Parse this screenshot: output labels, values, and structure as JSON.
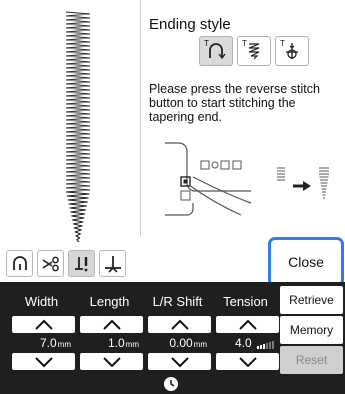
{
  "ending_style": {
    "title": "Ending style",
    "buttons": [
      {
        "prefix": "T",
        "icon": "reverse-tack-icon",
        "selected": true
      },
      {
        "prefix": "T",
        "icon": "zigzag-taper-icon",
        "selected": false
      },
      {
        "prefix": "T",
        "icon": "tie-off-icon",
        "selected": false
      }
    ],
    "instruction": "Please press the reverse stitch button to start stitching the tapering end."
  },
  "side_toolbar": {
    "buttons": [
      {
        "icon": "presser-foot-icon",
        "active": false
      },
      {
        "icon": "scissors-icon",
        "active": false
      },
      {
        "icon": "needle-stop-icon",
        "active": true
      },
      {
        "icon": "pivot-icon",
        "active": false
      }
    ]
  },
  "close_label": "Close",
  "dials": [
    {
      "label": "Width",
      "value": "7.0",
      "unit": "mm"
    },
    {
      "label": "Length",
      "value": "1.0",
      "unit": "mm"
    },
    {
      "label": "L/R Shift",
      "value": "0.00",
      "unit": "mm"
    },
    {
      "label": "Tension",
      "value": "4.0",
      "unit": ""
    }
  ],
  "menu": {
    "retrieve": "Retrieve",
    "memory": "Memory",
    "reset": "Reset"
  },
  "colors": {
    "accent": "#2f7fe6",
    "panel": "#1f1f1f"
  }
}
